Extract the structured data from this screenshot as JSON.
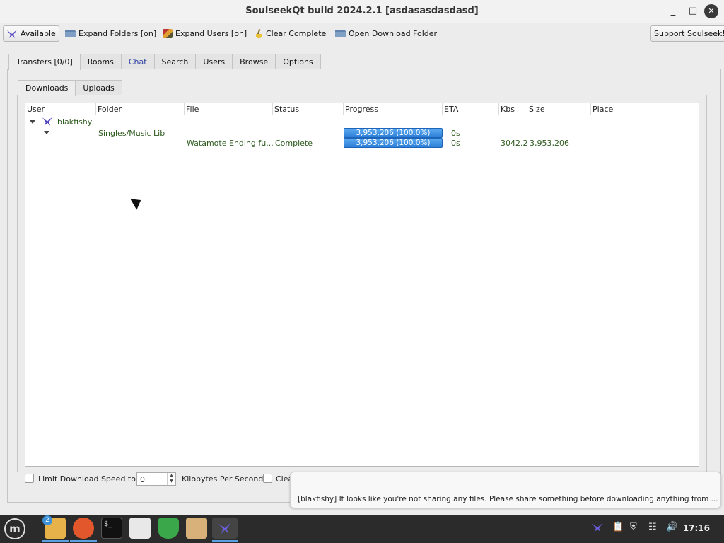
{
  "window": {
    "title": "SoulseekQt build 2024.2.1 [asdasasdasdasd]"
  },
  "toolbar": {
    "available_label": "Available",
    "expand_folders_label": "Expand Folders [on]",
    "expand_users_label": "Expand Users [on]",
    "clear_complete_label": "Clear Complete",
    "open_download_folder_label": "Open Download Folder",
    "support_label": "Support Soulseek!"
  },
  "main_tabs": [
    "Transfers [0/0]",
    "Rooms",
    "Chat",
    "Search",
    "Users",
    "Browse",
    "Options"
  ],
  "sub_tabs": [
    "Downloads",
    "Uploads"
  ],
  "table": {
    "columns": [
      "User",
      "Folder",
      "File",
      "Status",
      "Progress",
      "ETA",
      "Kbs",
      "Size",
      "Place"
    ],
    "user": "blakfishy",
    "folder": {
      "name": "Singles/Music Lib",
      "progress_text": "3,953,206 (100.0%)",
      "progress": 1.0,
      "eta": "0s"
    },
    "file": {
      "name": "Watamote Ending fu...",
      "status": "Complete",
      "progress_text": "3,953,206 (100.0%)",
      "progress": 1.0,
      "eta": "0s",
      "kbs": "3042.2",
      "size": "3,953,206"
    }
  },
  "bottom": {
    "limit_label": "Limit Download Speed to",
    "limit_value": "0",
    "unit_label": "Kilobytes Per Second",
    "clear_label": "Clea"
  },
  "notification": {
    "message": "[blakfishy] It looks like you're not sharing any files. Please share something before downloading anything from  ..."
  },
  "taskbar": {
    "files_badge": "2",
    "clock": "17:16"
  },
  "colors": {
    "progress": "#2d7fd8",
    "accent": "#5aa0e0",
    "taskbar": "#2b2b2b"
  }
}
